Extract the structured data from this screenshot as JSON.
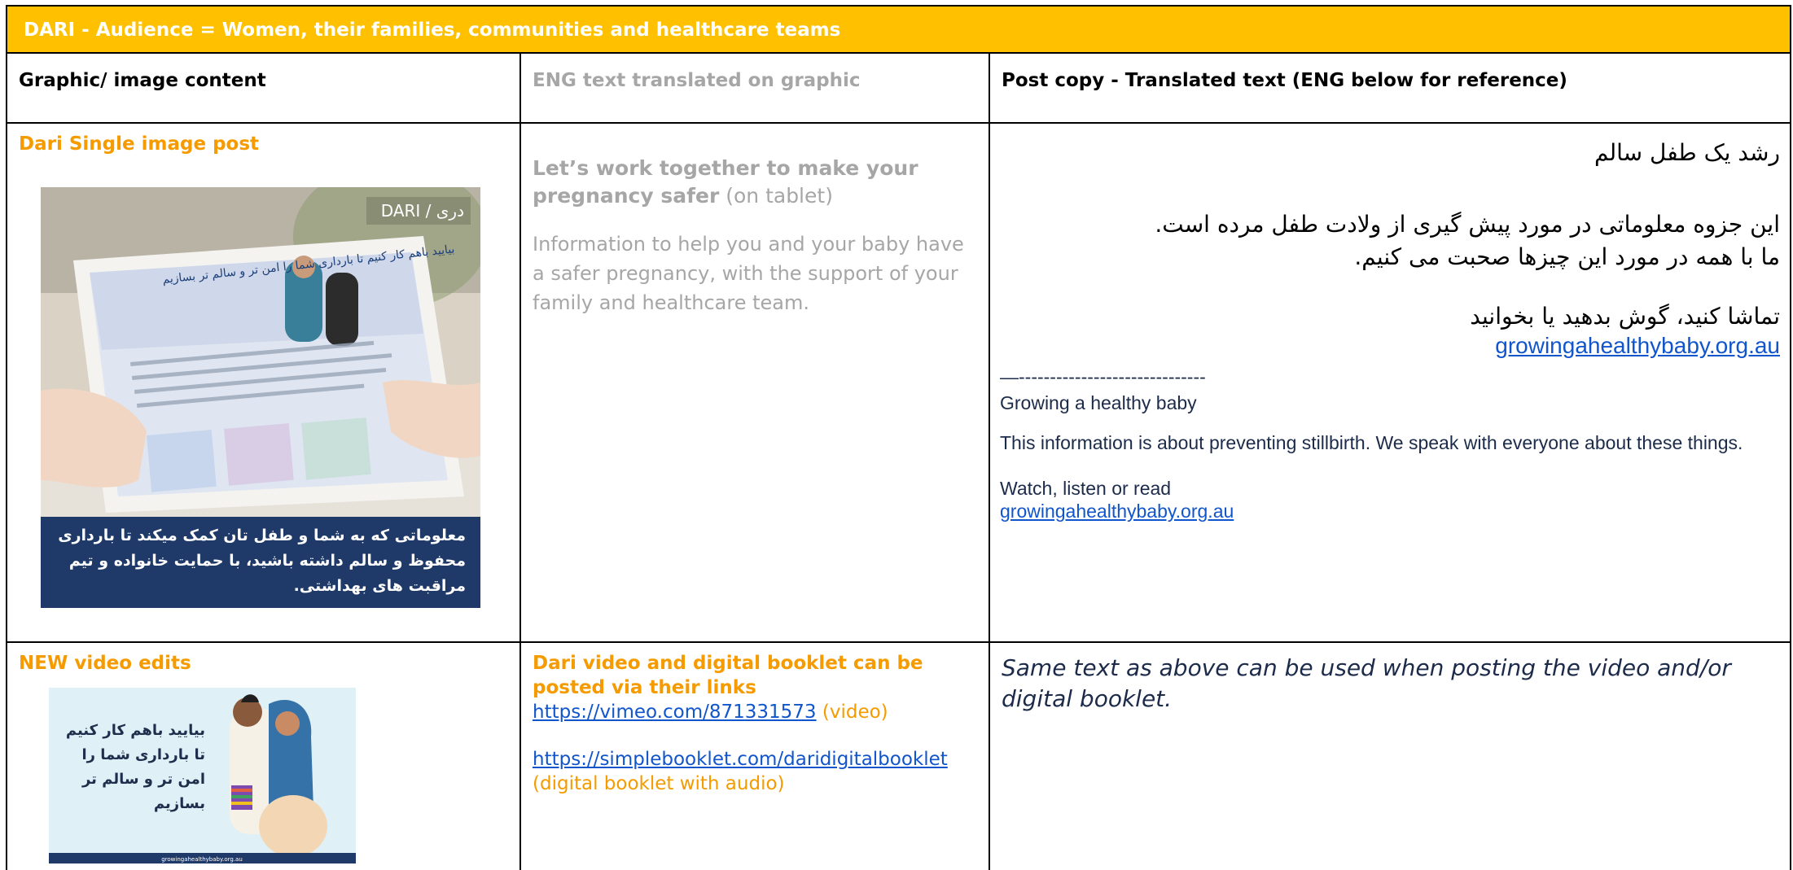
{
  "banner": "DARI - Audience = Women, their families, communities and healthcare teams",
  "headers": {
    "col1": "Graphic/ image content",
    "col2": "ENG text translated on graphic",
    "col3": "Post copy - Translated text (ENG below for reference)"
  },
  "row1": {
    "col1_title": "Dari Single image post",
    "image": {
      "tag": "DARI / دری",
      "tablet_heading": "بیایید باهم کار کنیم تا بارداری شما را امن تر و سالم تر بسازیم",
      "caption": "معلوماتی که به شما و طفل تان کمک میکند تا بارداری محفوظ و سالم داشته باشید، با حمایت خانواده و تیم مراقبت های بهداشتی."
    },
    "col2_bold": "Let’s work together to make your pregnancy safer",
    "col2_suffix": " (on tablet)",
    "col2_body": "Information to help you and your baby have a safer pregnancy, with the support of your family and healthcare team.",
    "fa_title": "رشد یک طفل سالم",
    "fa_body_1": "این جزوه معلوماتی در مورد پیش گیری از ولادت طفل مرده است.",
    "fa_body_2": "ما با همه در مورد این چیزها صحبت می کنیم.",
    "fa_watch": "تماشا کنید، گوش بدهید یا بخوانید",
    "fa_link": "growingahealthybaby.org.au",
    "divider": "—------------------------------",
    "en_title": "Growing a healthy baby",
    "en_body": "This information is about preventing stillbirth. We speak with everyone about these things.",
    "en_watch": "Watch, listen or read",
    "en_link": "growingahealthybaby.org.au"
  },
  "row2": {
    "col1_title": "NEW video edits",
    "video_text": "بیایید باهم کار کنیم تا بارداری شما را امن تر و سالم تر بسازیم",
    "video_footer": "growingahealthybaby.org.au",
    "col2_title": "Dari video and digital booklet can be posted via their links",
    "vimeo_link": "https://vimeo.com/871331573",
    "vimeo_suffix": " (video)",
    "booklet_link": "https://simplebooklet.com/daridigitalbooklet",
    "booklet_suffix": "  (digital booklet with audio)",
    "col3_text": "Same text as above can be used when posting the video and/or digital booklet."
  }
}
